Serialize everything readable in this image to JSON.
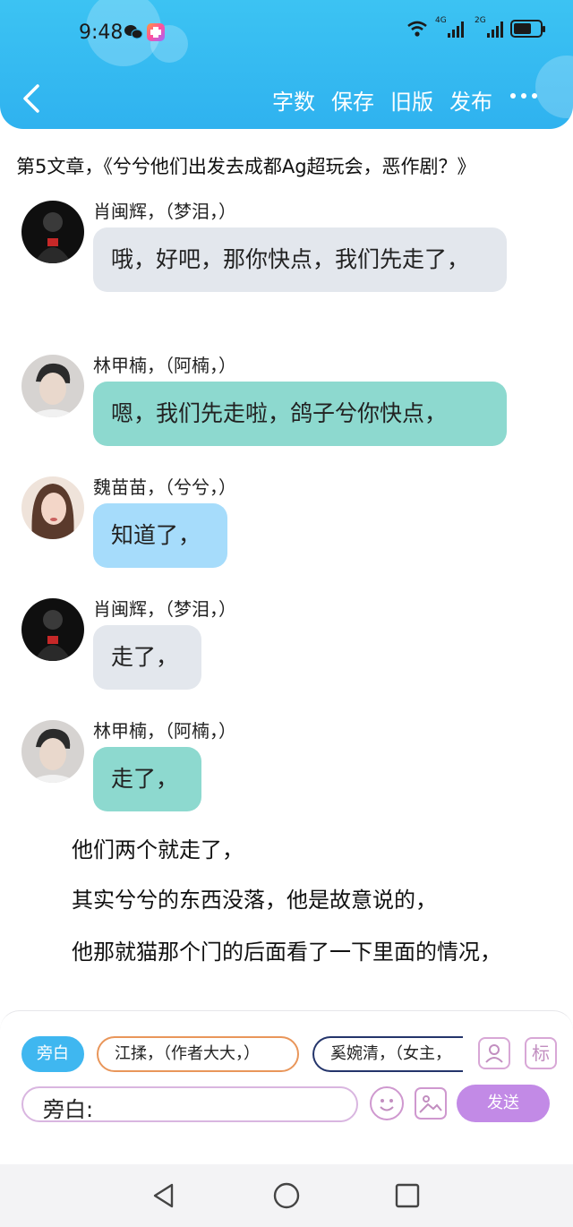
{
  "status_bar": {
    "time": "9:48",
    "net1": "4G",
    "net2": "2G"
  },
  "toolbar": {
    "word_count": "字数",
    "save": "保存",
    "old_version": "旧版",
    "publish": "发布"
  },
  "article_title": "第5文章，《兮兮他们出发去成都Ag超玩会，恶作剧？》",
  "messages": [
    {
      "name": "肖闽辉，（梦泪，）",
      "text": "哦，好吧，那你快点，我们先走了，",
      "color": "gray"
    },
    {
      "name": "林甲楠，（阿楠，）",
      "text": "嗯，我们先走啦，鸽子兮你快点，",
      "color": "teal"
    },
    {
      "name": "魏苗苗，（兮兮，）",
      "text": "知道了，",
      "color": "blue"
    },
    {
      "name": "肖闽辉，（梦泪，）",
      "text": "走了，",
      "color": "gray"
    },
    {
      "name": "林甲楠，（阿楠，）",
      "text": "走了，",
      "color": "teal"
    }
  ],
  "narration": [
    "他们两个就走了，",
    "其实兮兮的东西没落，他是故意说的，",
    "他那就猫那个门的后面看了一下里面的情况，"
  ],
  "compose": {
    "chips": [
      "旁白",
      "江揉，（作者大大，）",
      "奚婉清，（女主，"
    ],
    "mark_label": "标",
    "input_label": "旁白:",
    "send_label": "发送"
  },
  "colors": {
    "header": "#36bcf2",
    "accent_purple": "#c28ae6",
    "bubble_gray": "#e3e7ed",
    "bubble_teal": "#8dd9cf",
    "bubble_blue": "#a6dcfb"
  }
}
